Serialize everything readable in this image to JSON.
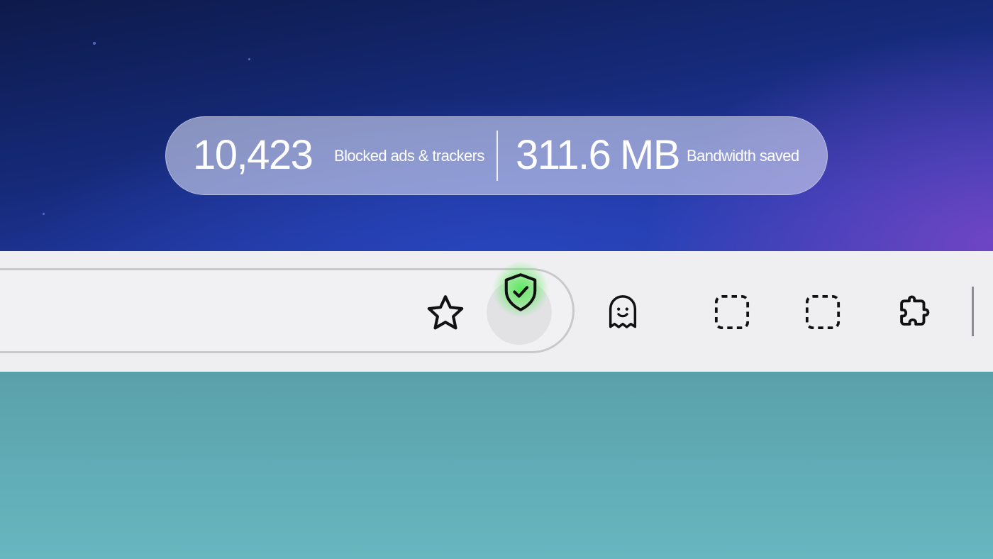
{
  "stats": {
    "blocked_count": "10,423",
    "blocked_label": "Blocked ads & trackers",
    "bandwidth_value": "311.6",
    "bandwidth_unit": "MB",
    "bandwidth_label": "Bandwidth saved"
  },
  "toolbar": {
    "icons": {
      "bookmark": "star-icon",
      "shields": "shield-check-icon",
      "private": "ghost-icon",
      "slot_1": "dashed-square-icon",
      "slot_2": "dashed-square-icon",
      "extensions": "puzzle-icon"
    },
    "shield_status_color": "#4be84b"
  },
  "colors": {
    "background_top": "#162a7a",
    "toolbar": "#efeff1",
    "background_bottom": "#62aeb8"
  }
}
